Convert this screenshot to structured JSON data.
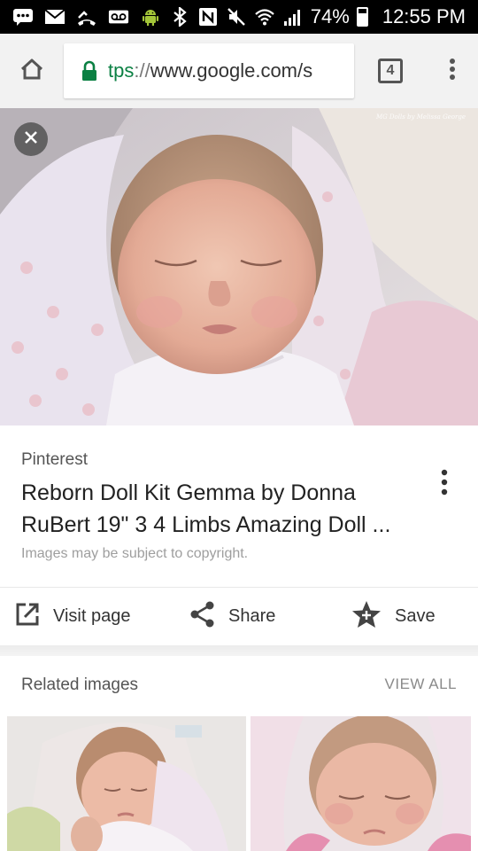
{
  "status_bar": {
    "battery_percent": "74%",
    "battery_level": 0.74,
    "time": "12:55 PM"
  },
  "browser": {
    "url_scheme": "tps",
    "url_separator": "://",
    "url_host": "www.google.com/s",
    "tab_count": "4"
  },
  "result": {
    "source": "Pinterest",
    "title": "Reborn Doll Kit Gemma by Donna RuBert 19\" 3 4 Limbs Amazing Doll ...",
    "copyright_notice": "Images may be subject to copyright."
  },
  "actions": {
    "visit_label": "Visit page",
    "share_label": "Share",
    "save_label": "Save"
  },
  "related": {
    "title": "Related images",
    "view_all_label": "VIEW ALL"
  },
  "colors": {
    "secure_green": "#0b8043",
    "toolbar_bg": "#f2f2f2"
  }
}
